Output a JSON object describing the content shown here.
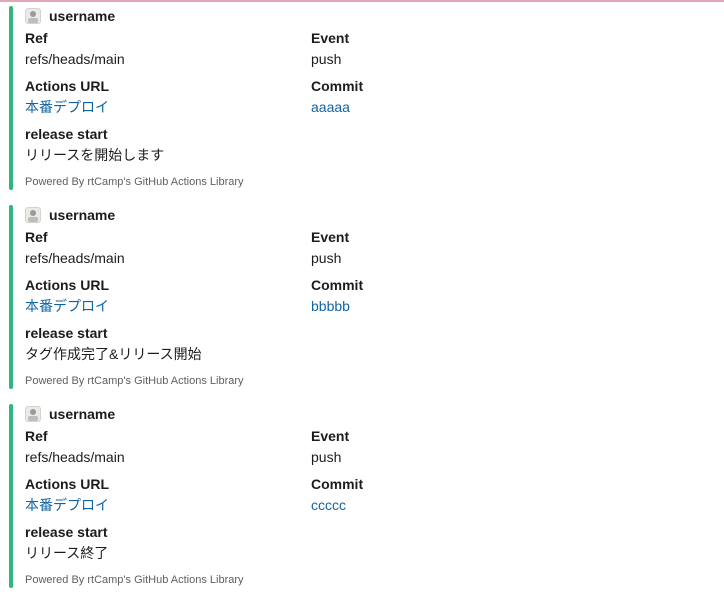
{
  "messages": [
    {
      "author": "username",
      "fields": {
        "ref_title": "Ref",
        "ref_value": "refs/heads/main",
        "event_title": "Event",
        "event_value": "push",
        "actions_title": "Actions URL",
        "actions_value": "本番デプロイ",
        "commit_title": "Commit",
        "commit_value": "aaaaa",
        "release_title": "release start",
        "release_value": "リリースを開始します"
      },
      "footer": "Powered By rtCamp's GitHub Actions Library"
    },
    {
      "author": "username",
      "fields": {
        "ref_title": "Ref",
        "ref_value": "refs/heads/main",
        "event_title": "Event",
        "event_value": "push",
        "actions_title": "Actions URL",
        "actions_value": "本番デプロイ",
        "commit_title": "Commit",
        "commit_value": "bbbbb",
        "release_title": "release start",
        "release_value": "タグ作成完了&リリース開始"
      },
      "footer": "Powered By rtCamp's GitHub Actions Library"
    },
    {
      "author": "username",
      "fields": {
        "ref_title": "Ref",
        "ref_value": "refs/heads/main",
        "event_title": "Event",
        "event_value": "push",
        "actions_title": "Actions URL",
        "actions_value": "本番デプロイ",
        "commit_title": "Commit",
        "commit_value": "ccccc",
        "release_title": "release start",
        "release_value": "リリース終了"
      },
      "footer": "Powered By rtCamp's GitHub Actions Library"
    }
  ],
  "colors": {
    "attachment_bar": "#2eb67d",
    "link": "#1264a3"
  }
}
